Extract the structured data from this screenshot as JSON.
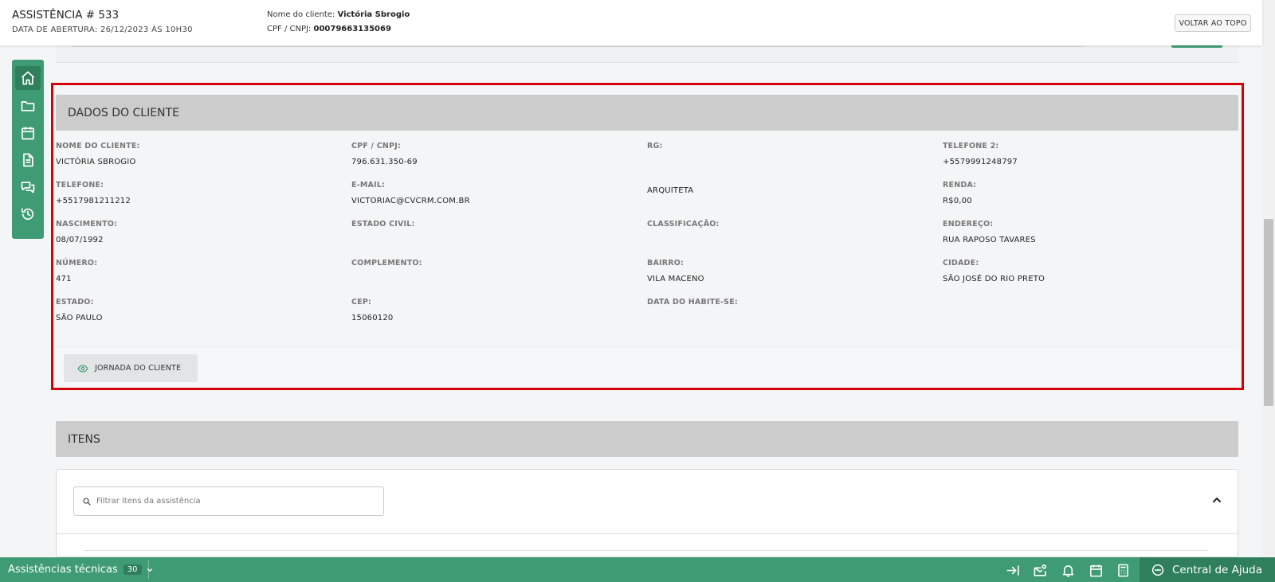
{
  "header": {
    "title": "ASSISTÊNCIA # 533",
    "opening": "DATA DE ABERTURA: 26/12/2023 ÀS 10H30",
    "client_label": "Nome do cliente:",
    "client_name": "Victória Sbrogio",
    "doc_label": "CPF / CNPJ:",
    "doc_value": "00079663135069",
    "back_top": "VOLTAR AO TOPO"
  },
  "sidebar": {
    "items": [
      {
        "name": "home",
        "active": true
      },
      {
        "name": "folder"
      },
      {
        "name": "calendar"
      },
      {
        "name": "document"
      },
      {
        "name": "chat"
      },
      {
        "name": "history"
      }
    ]
  },
  "client": {
    "section_title": "DADOS DO CLIENTE",
    "fields": [
      {
        "label": "NOME DO CLIENTE:",
        "value": "VICTÓRIA SBROGIO"
      },
      {
        "label": "CPF / CNPJ:",
        "value": "796.631.350-69"
      },
      {
        "label": "RG:",
        "value": ""
      },
      {
        "label": "TELEFONE 2:",
        "value": "+5579991248797"
      },
      {
        "label": "TELEFONE:",
        "value": "+5517981211212"
      },
      {
        "label": "E-MAIL:",
        "value": "VICTORIAC@CVCRM.COM.BR"
      },
      {
        "label": "",
        "value": "ARQUITETA"
      },
      {
        "label": "RENDA:",
        "value": "R$0,00"
      },
      {
        "label": "NASCIMENTO:",
        "value": "08/07/1992"
      },
      {
        "label": "ESTADO CIVIL:",
        "value": ""
      },
      {
        "label": "CLASSIFICAÇÃO:",
        "value": ""
      },
      {
        "label": "ENDEREÇO:",
        "value": "RUA RAPOSO TAVARES"
      },
      {
        "label": "NÚMERO:",
        "value": "471"
      },
      {
        "label": "COMPLEMENTO:",
        "value": ""
      },
      {
        "label": "BAIRRO:",
        "value": "VILA MACENO"
      },
      {
        "label": "CIDADE:",
        "value": "SÃO JOSÉ DO RIO PRETO"
      },
      {
        "label": "ESTADO:",
        "value": "SÃO PAULO"
      },
      {
        "label": "CEP:",
        "value": "15060120"
      },
      {
        "label": "DATA DO HABITE-SE:",
        "value": ""
      }
    ],
    "journey_button": "JORNADA DO CLIENTE"
  },
  "items": {
    "section_title": "ITENS",
    "search_placeholder": "Filtrar itens da assistência"
  },
  "bottombar": {
    "module": "Assistências técnicas",
    "count": "30",
    "help": "Central de Ajuda"
  },
  "colors": {
    "accent": "#3f9b74",
    "accent_dark": "#2f7f5d",
    "highlight": "#d0020a",
    "section_bar": "#cccccc"
  }
}
